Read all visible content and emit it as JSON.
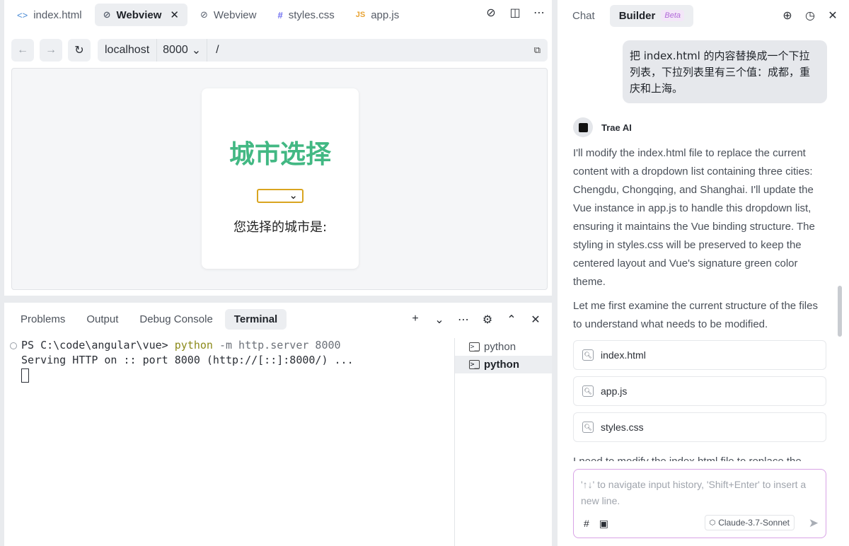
{
  "editor": {
    "tabs": [
      {
        "icon": "code-icon",
        "glyph": "<>",
        "label": "index.html",
        "active": false
      },
      {
        "icon": "link-icon",
        "glyph": "⊘",
        "label": "Webview",
        "active": true
      },
      {
        "icon": "link-icon",
        "glyph": "⊘",
        "label": "Webview",
        "active": false
      },
      {
        "icon": "hash-icon",
        "glyph": "#",
        "label": "styles.css",
        "active": false
      },
      {
        "icon": "js-icon",
        "glyph": "JS",
        "label": "app.js",
        "active": false
      }
    ],
    "close_glyph": "✕",
    "actions": {
      "compass": "⊘",
      "split": "◫",
      "more": "⋯"
    }
  },
  "webview": {
    "back": "←",
    "forward": "→",
    "reload": "↻",
    "host": "localhost",
    "port": "8000",
    "path": "/",
    "copy_glyph": "⧉",
    "page": {
      "title": "城市选择",
      "select_value": "",
      "result_label": "您选择的城市是:"
    }
  },
  "panel": {
    "tabs": [
      "Problems",
      "Output",
      "Debug Console",
      "Terminal"
    ],
    "active_tab": "Terminal",
    "actions": {
      "add": "+",
      "dropdown": "⌄",
      "more": "⋯",
      "settings": "⚙",
      "maximize": "⌃",
      "close": "✕"
    },
    "terminal": {
      "prompt": "PS C:\\code\\angular\\vue> ",
      "command": "python",
      "args": " -m http.server 8000",
      "output": "Serving HTTP on :: port 8000 (http://[::]:8000/) ..."
    },
    "terminal_list": [
      {
        "label": "python",
        "active": false
      },
      {
        "label": "python",
        "active": true
      }
    ]
  },
  "chat": {
    "tabs": {
      "chat": "Chat",
      "builder": "Builder",
      "beta": "Beta"
    },
    "header_actions": {
      "new": "⊕",
      "history": "◷",
      "close": "✕"
    },
    "user_message": "把 index.html 的内容替换成一个下拉列表，下拉列表里有三个值：成都，重庆和上海。",
    "assistant_name": "Trae AI",
    "assistant_text": "I'll modify the index.html file to replace the current content with a dropdown list containing three cities: Chengdu, Chongqing, and Shanghai. I'll update the Vue instance in app.js to handle this dropdown list, ensuring it maintains the Vue binding structure. The styling in styles.css will be preserved to keep the centered layout and Vue's signature green color theme.",
    "assistant_text2": "Let me first examine the current structure of the files to understand what needs to be modified.",
    "files": [
      "index.html",
      "app.js",
      "styles.css"
    ],
    "truncated_text": "I need to modify the index.html file to replace the",
    "input_placeholder": "'↑↓' to navigate input history, 'Shift+Enter' to insert a new line.",
    "model": "Claude-3.7-Sonnet",
    "tool_hash": "#",
    "tool_image": "▣",
    "send_glyph": "➤"
  },
  "colors": {
    "vue_green": "#42b883",
    "select_border": "#d9a520",
    "input_border": "#d8a3e6",
    "beta_badge": "#b26bd9"
  }
}
